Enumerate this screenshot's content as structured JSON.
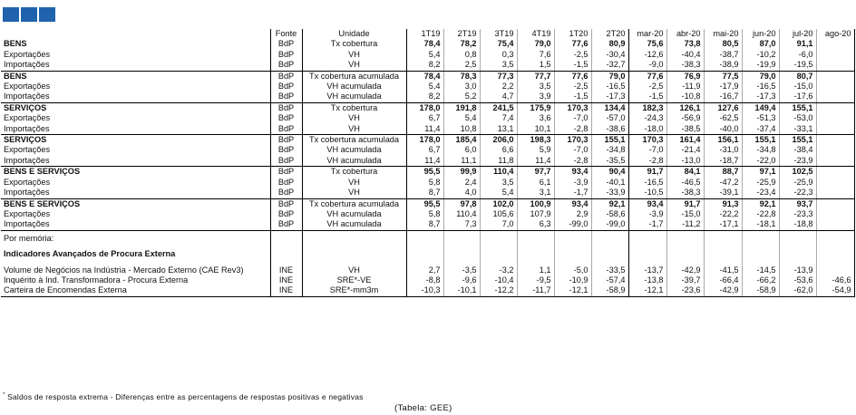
{
  "header": {
    "fonte": "Fonte",
    "unidade": "Unidade",
    "periods": [
      "1T19",
      "2T19",
      "3T19",
      "4T19",
      "1T20",
      "2T20",
      "mar-20",
      "abr-20",
      "mai-20",
      "jun-20",
      "jul-20",
      "ago-20"
    ]
  },
  "blocks": [
    {
      "rows": [
        {
          "label": "BENS",
          "fonte": "BdP",
          "unit": "Tx cobertura",
          "vals": [
            "78,4",
            "78,2",
            "75,4",
            "79,0",
            "77,6",
            "80,9",
            "75,6",
            "73,8",
            "80,5",
            "87,0",
            "91,1",
            ""
          ],
          "bold": true
        },
        {
          "label": "Exportações",
          "fonte": "BdP",
          "unit": "VH",
          "vals": [
            "5,4",
            "0,8",
            "0,3",
            "7,6",
            "-2,5",
            "-30,4",
            "-12,6",
            "-40,4",
            "-38,7",
            "-10,2",
            "-6,0",
            ""
          ]
        },
        {
          "label": "Importações",
          "fonte": "BdP",
          "unit": "VH",
          "vals": [
            "8,2",
            "2,5",
            "3,5",
            "1,5",
            "-1,5",
            "-32,7",
            "-9,0",
            "-38,3",
            "-38,9",
            "-19,9",
            "-19,5",
            ""
          ]
        }
      ]
    },
    {
      "rows": [
        {
          "label": "BENS",
          "fonte": "BdP",
          "unit": "Tx cobertura acumulada",
          "vals": [
            "78,4",
            "78,3",
            "77,3",
            "77,7",
            "77,6",
            "79,0",
            "77,6",
            "76,9",
            "77,5",
            "79,0",
            "80,7",
            ""
          ],
          "bold": true
        },
        {
          "label": "Exportações",
          "fonte": "BdP",
          "unit": "VH acumulada",
          "vals": [
            "5,4",
            "3,0",
            "2,2",
            "3,5",
            "-2,5",
            "-16,5",
            "-2,5",
            "-11,9",
            "-17,9",
            "-16,5",
            "-15,0",
            ""
          ]
        },
        {
          "label": "Importações",
          "fonte": "BdP",
          "unit": "VH acumulada",
          "vals": [
            "8,2",
            "5,2",
            "4,7",
            "3,9",
            "-1,5",
            "-17,3",
            "-1,5",
            "-10,8",
            "-16,7",
            "-17,3",
            "-17,6",
            ""
          ]
        }
      ]
    },
    {
      "rows": [
        {
          "label": "SERVIÇOS",
          "fonte": "BdP",
          "unit": "Tx cobertura",
          "vals": [
            "178,0",
            "191,8",
            "241,5",
            "175,9",
            "170,3",
            "134,4",
            "182,3",
            "126,1",
            "127,6",
            "149,4",
            "155,1",
            ""
          ],
          "bold": true
        },
        {
          "label": "Exportações",
          "fonte": "BdP",
          "unit": "VH",
          "vals": [
            "6,7",
            "5,4",
            "7,4",
            "3,6",
            "-7,0",
            "-57,0",
            "-24,3",
            "-56,9",
            "-62,5",
            "-51,3",
            "-53,0",
            ""
          ]
        },
        {
          "label": "Importações",
          "fonte": "BdP",
          "unit": "VH",
          "vals": [
            "11,4",
            "10,8",
            "13,1",
            "10,1",
            "-2,8",
            "-38,6",
            "-18,0",
            "-38,5",
            "-40,0",
            "-37,4",
            "-33,1",
            ""
          ]
        }
      ]
    },
    {
      "rows": [
        {
          "label": "SERVIÇOS",
          "fonte": "BdP",
          "unit": "Tx cobertura acumulada",
          "vals": [
            "178,0",
            "185,4",
            "206,0",
            "198,3",
            "170,3",
            "155,1",
            "170,3",
            "161,4",
            "156,1",
            "155,1",
            "155,1",
            ""
          ],
          "bold": true
        },
        {
          "label": "Exportações",
          "fonte": "BdP",
          "unit": "VH acumulada",
          "vals": [
            "6,7",
            "6,0",
            "6,6",
            "5,9",
            "-7,0",
            "-34,8",
            "-7,0",
            "-21,4",
            "-31,0",
            "-34,8",
            "-38,4",
            ""
          ]
        },
        {
          "label": "Importações",
          "fonte": "BdP",
          "unit": "VH acumulada",
          "vals": [
            "11,4",
            "11,1",
            "11,8",
            "11,4",
            "-2,8",
            "-35,5",
            "-2,8",
            "-13,0",
            "-18,7",
            "-22,0",
            "-23,9",
            ""
          ]
        }
      ]
    },
    {
      "rows": [
        {
          "label": "BENS E SERVIÇOS",
          "fonte": "BdP",
          "unit": "Tx cobertura",
          "vals": [
            "95,5",
            "99,9",
            "110,4",
            "97,7",
            "93,4",
            "90,4",
            "91,7",
            "84,1",
            "88,7",
            "97,1",
            "102,5",
            ""
          ],
          "bold": true
        },
        {
          "label": "Exportações",
          "fonte": "BdP",
          "unit": "VH",
          "vals": [
            "5,8",
            "2,4",
            "3,5",
            "6,1",
            "-3,9",
            "-40,1",
            "-16,5",
            "-46,5",
            "-47,2",
            "-25,9",
            "-25,9",
            ""
          ]
        },
        {
          "label": "Importações",
          "fonte": "BdP",
          "unit": "VH",
          "vals": [
            "8,7",
            "4,0",
            "5,4",
            "3,1",
            "-1,7",
            "-33,9",
            "-10,5",
            "-38,3",
            "-39,1",
            "-23,4",
            "-22,3",
            ""
          ]
        }
      ]
    },
    {
      "rows": [
        {
          "label": "BENS E SERVIÇOS",
          "fonte": "BdP",
          "unit": "Tx cobertura acumulada",
          "vals": [
            "95,5",
            "97,8",
            "102,0",
            "100,9",
            "93,4",
            "92,1",
            "93,4",
            "91,7",
            "91,3",
            "92,1",
            "93,7",
            ""
          ],
          "bold": true
        },
        {
          "label": "Exportações",
          "fonte": "BdP",
          "unit": "VH acumulada",
          "vals": [
            "5,8",
            "110,4",
            "105,6",
            "107,9",
            "2,9",
            "-58,6",
            "-3,9",
            "-15,0",
            "-22,2",
            "-22,8",
            "-23,3",
            ""
          ]
        },
        {
          "label": "Importações",
          "fonte": "BdP",
          "unit": "VH acumulada",
          "vals": [
            "8,7",
            "7,3",
            "7,0",
            "6,3",
            "-99,0",
            "-99,0",
            "-1,7",
            "-11,2",
            "-17,1",
            "-18,1",
            "-18,8",
            ""
          ]
        }
      ]
    }
  ],
  "memo": {
    "label": "Por memória:",
    "title": "Indicadores Avançados de Procura Externa",
    "rows": [
      {
        "label": "Volume de Negócios na Indústria - Mercado Externo (CAE Rev3)",
        "fonte": "INE",
        "unit": "VH",
        "vals": [
          "2,7",
          "-3,5",
          "-3,2",
          "1,1",
          "-5,0",
          "-33,5",
          "-13,7",
          "-42,9",
          "-41,5",
          "-14,5",
          "-13,9",
          ""
        ]
      },
      {
        "label": "Inquérito à Ind. Transformadora - Procura Externa",
        "fonte": "INE",
        "unit": "SRE*-VE",
        "vals": [
          "-8,8",
          "-9,6",
          "-10,4",
          "-9,5",
          "-10,9",
          "-57,4",
          "-13,8",
          "-39,7",
          "-66,4",
          "-66,2",
          "-53,6",
          "-46,6"
        ]
      },
      {
        "label": "Carteira de Encomendas Externa",
        "fonte": "INE",
        "unit": "SRE*-mm3m",
        "vals": [
          "-10,3",
          "-10,1",
          "-12,2",
          "-11,7",
          "-12,1",
          "-58,9",
          "-12,1",
          "-23,6",
          "-42,9",
          "-58,9",
          "-62,0",
          "-54,9"
        ]
      }
    ]
  },
  "footnote": "Saldos de resposta extrema - Diferenças entre as percentagens de respostas positivas e negativas",
  "footnote_mark": "*",
  "source": "(Tabela: GEE)"
}
